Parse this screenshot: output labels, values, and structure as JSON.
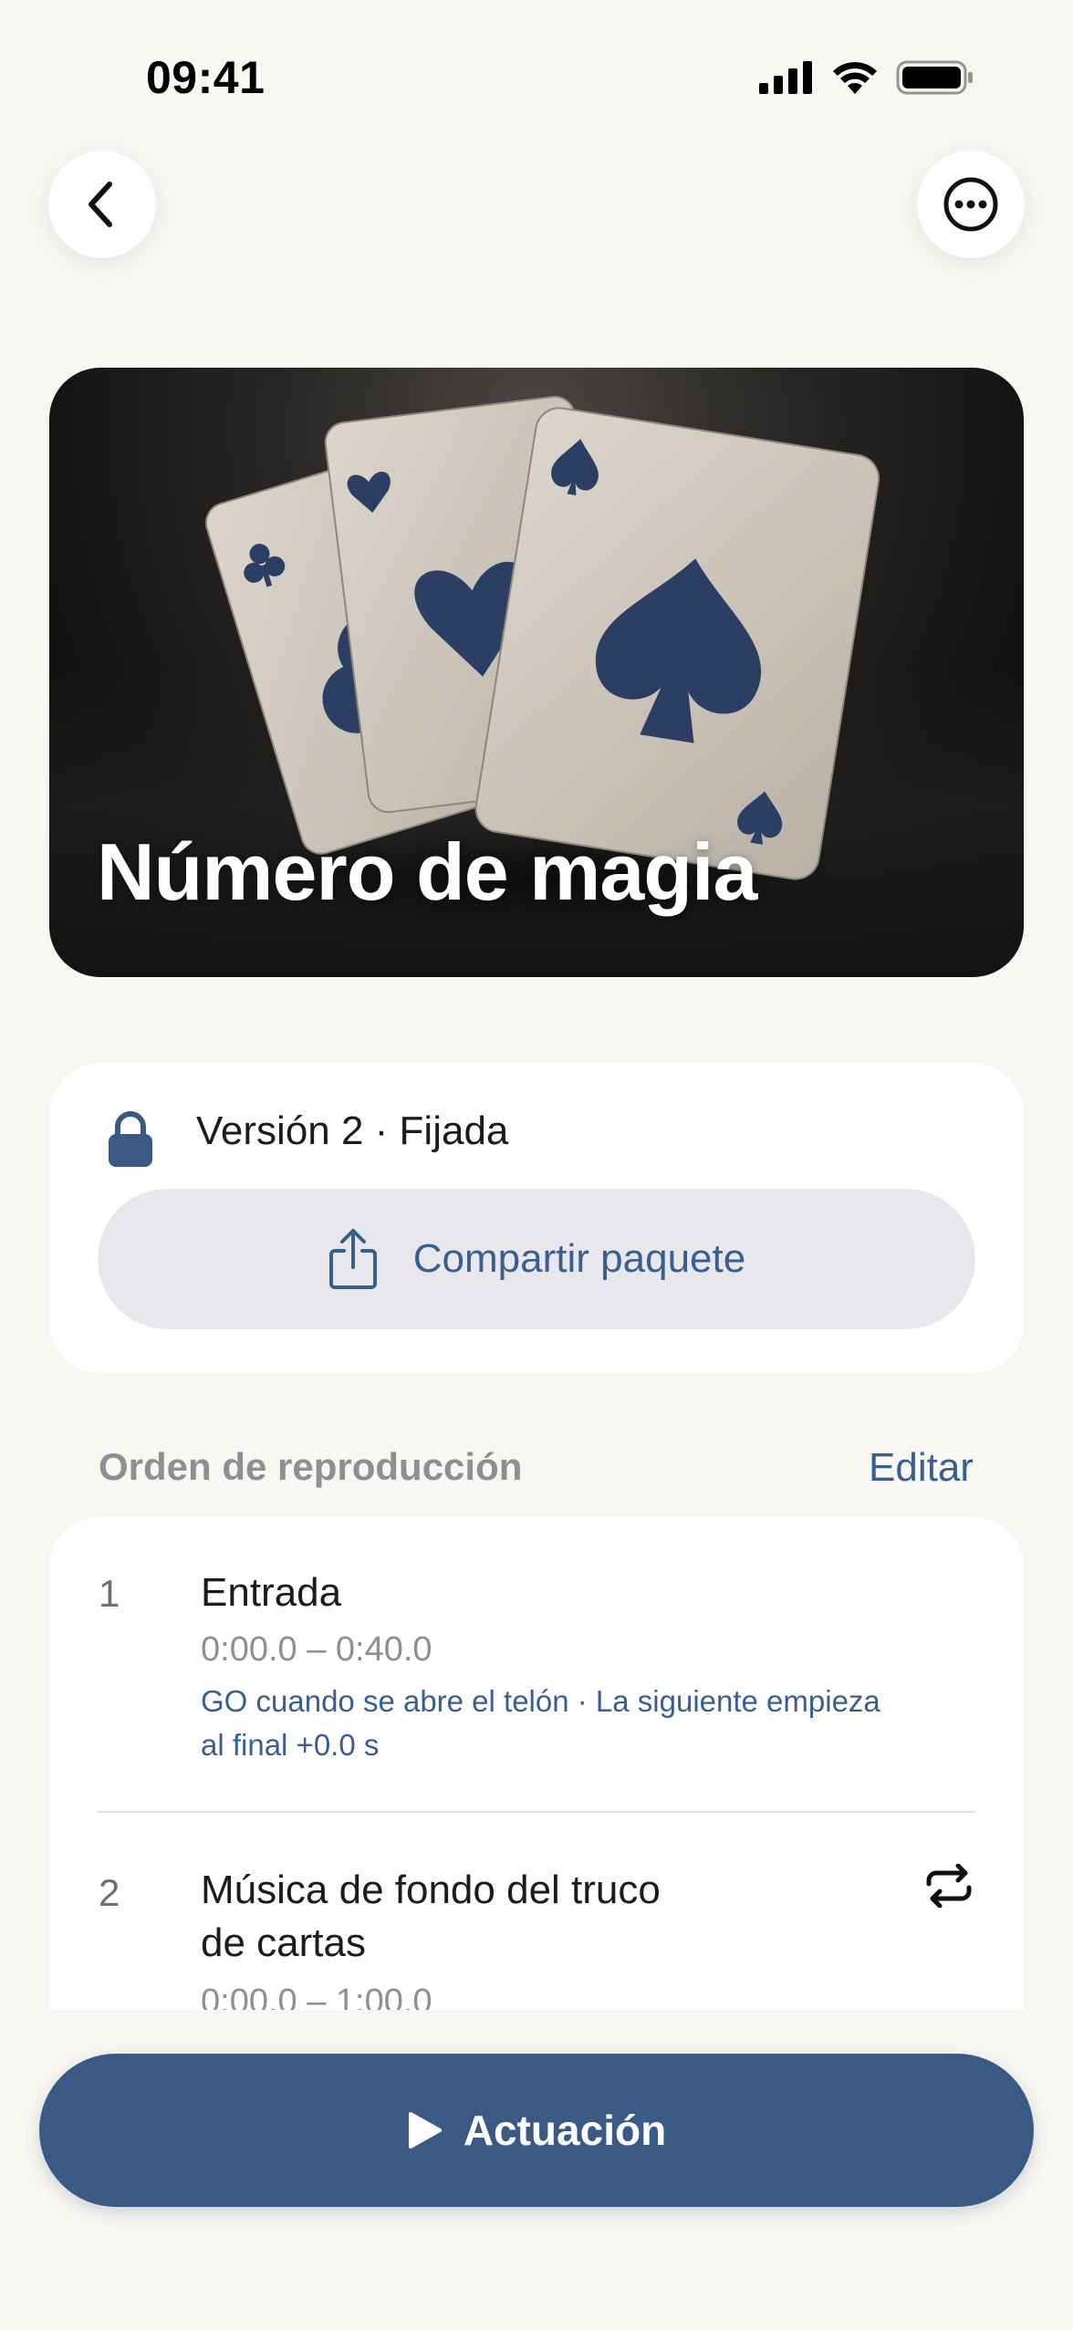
{
  "status_bar": {
    "time": "09:41"
  },
  "header": {
    "back_icon": "chevron-left-icon",
    "more_icon": "ellipsis-circle-icon"
  },
  "hero": {
    "title": "Número de magia"
  },
  "version": {
    "label": "Versión 2 · Fijada",
    "share_label": "Compartir paquete"
  },
  "playlist": {
    "section_title": "Orden de reproducción",
    "edit_label": "Editar",
    "cues": [
      {
        "number": "1",
        "name": "Entrada",
        "time": "0:00.0 – 0:40.0",
        "note_line1": "GO cuando se abre el telón · La siguiente empieza",
        "note_line2": "al final +0.0 s"
      },
      {
        "number": "2",
        "name_line1": "Música de fondo del truco",
        "name_line2": "de cartas",
        "time": "0:00.0 – 1:00.0",
        "loop_icon": "repeat-icon"
      }
    ]
  },
  "actions": {
    "perform_label": "Actuación"
  },
  "colors": {
    "accent": "#3a5f8f",
    "button": "#3a5a85",
    "background": "#f8f7f4"
  }
}
